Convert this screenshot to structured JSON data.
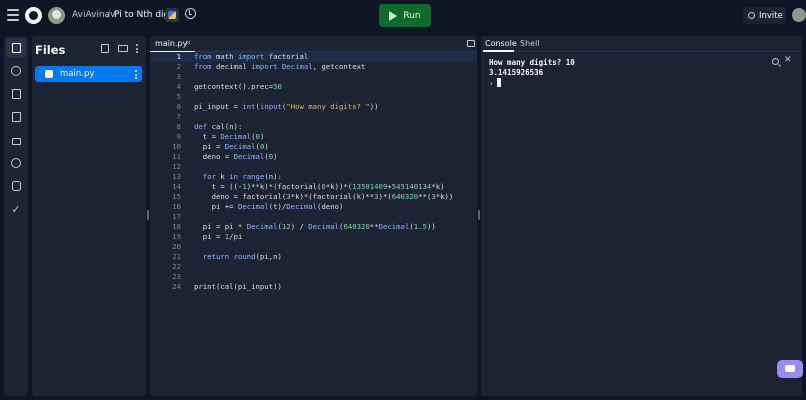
{
  "topbar": {
    "owner": "AviAvinav",
    "separator": "/",
    "repl_name": "Pi to Nth digit",
    "run_label": "Run",
    "invite_label": "Invite"
  },
  "files": {
    "title": "Files",
    "items": [
      {
        "name": "main.py",
        "language": "python"
      }
    ]
  },
  "editor": {
    "tab_label": "main.py",
    "tab_close": "×",
    "current_line": 1,
    "lines": [
      {
        "n": "1",
        "text": "from math import factorial"
      },
      {
        "n": "2",
        "text": "from decimal import Decimal, getcontext"
      },
      {
        "n": "3",
        "text": ""
      },
      {
        "n": "4",
        "text": "getcontext().prec=50"
      },
      {
        "n": "5",
        "text": ""
      },
      {
        "n": "6",
        "text": "pi_input = int(input(\"How many digits? \"))"
      },
      {
        "n": "7",
        "text": ""
      },
      {
        "n": "8",
        "text": "def cal(n):"
      },
      {
        "n": "9",
        "text": "  t = Decimal(0)"
      },
      {
        "n": "10",
        "text": "  pi = Decimal(0)"
      },
      {
        "n": "11",
        "text": "  deno = Decimal(0)"
      },
      {
        "n": "12",
        "text": ""
      },
      {
        "n": "13",
        "text": "  for k in range(n):"
      },
      {
        "n": "14",
        "text": "    t = ((-1)**k)*(factorial(6*k))*(13591409+545140134*k)"
      },
      {
        "n": "15",
        "text": "    deno = factorial(3*k)*(factorial(k)**3)*(640320**(3*k))"
      },
      {
        "n": "16",
        "text": "    pi += Decimal(t)/Decimal(deno)"
      },
      {
        "n": "17",
        "text": ""
      },
      {
        "n": "18",
        "text": "  pi = pi * Decimal(12) / Decimal(640320**Decimal(1.5))"
      },
      {
        "n": "19",
        "text": "  pi = 1/pi"
      },
      {
        "n": "20",
        "text": ""
      },
      {
        "n": "21",
        "text": "  return round(pi,n)"
      },
      {
        "n": "22",
        "text": ""
      },
      {
        "n": "23",
        "text": ""
      },
      {
        "n": "24",
        "text": "print(cal(pi_input))"
      }
    ]
  },
  "console": {
    "tabs": [
      "Console",
      "Shell"
    ],
    "output": [
      "How many digits? 10",
      "3.1415926536"
    ],
    "prompt": "›"
  },
  "help_label": "?",
  "colors": {
    "accent": "#0079f2",
    "run": "#0f6b2c",
    "bg": "#0e1525",
    "panel": "#1c2333"
  },
  "icons": {
    "rail": [
      "files-icon",
      "git-icon",
      "debugger-icon",
      "packages-icon",
      "secrets-icon",
      "settings-icon",
      "database-icon",
      "check-icon"
    ]
  }
}
